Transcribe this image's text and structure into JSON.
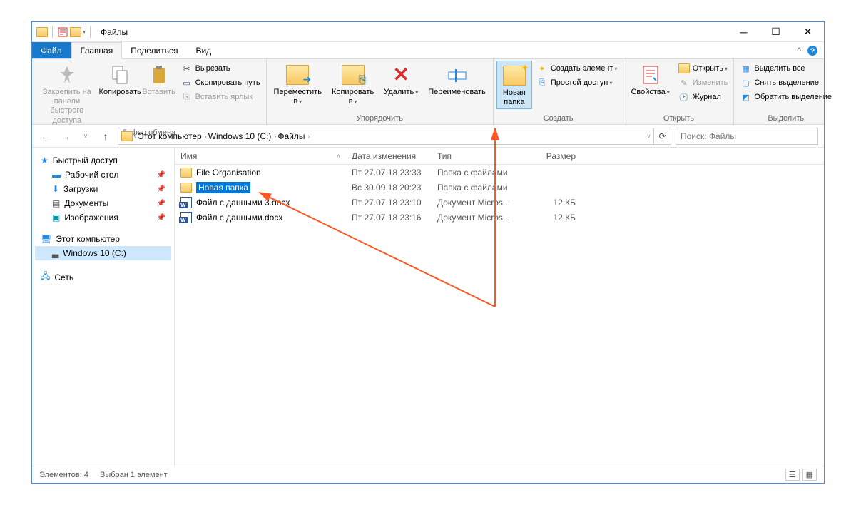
{
  "window": {
    "title": "Файлы"
  },
  "tabs": {
    "file": "Файл",
    "home": "Главная",
    "share": "Поделиться",
    "view": "Вид"
  },
  "ribbon": {
    "clipboard": {
      "label": "Буфер обмена",
      "pin": "Закрепить на панели\nбыстрого доступа",
      "copy": "Копировать",
      "paste": "Вставить",
      "cut": "Вырезать",
      "copy_path": "Скопировать путь",
      "paste_shortcut": "Вставить ярлык"
    },
    "organize": {
      "label": "Упорядочить",
      "move_to": "Переместить\nв",
      "copy_to": "Копировать\nв",
      "delete": "Удалить",
      "rename": "Переименовать"
    },
    "new": {
      "label": "Создать",
      "new_folder": "Новая\nпапка",
      "new_item": "Создать элемент",
      "easy_access": "Простой доступ"
    },
    "open": {
      "label": "Открыть",
      "properties": "Свойства",
      "open_btn": "Открыть",
      "edit": "Изменить",
      "history": "Журнал"
    },
    "select": {
      "label": "Выделить",
      "select_all": "Выделить все",
      "select_none": "Снять выделение",
      "invert": "Обратить выделение"
    }
  },
  "breadcrumbs": [
    "Этот компьютер",
    "Windows 10 (C:)",
    "Файлы"
  ],
  "search_placeholder": "Поиск: Файлы",
  "sidebar": {
    "quick_access": "Быстрый доступ",
    "desktop": "Рабочий стол",
    "downloads": "Загрузки",
    "documents": "Документы",
    "pictures": "Изображения",
    "this_pc": "Этот компьютер",
    "drive_c": "Windows 10 (C:)",
    "network": "Сеть"
  },
  "columns": {
    "name": "Имя",
    "date": "Дата изменения",
    "type": "Тип",
    "size": "Размер"
  },
  "files": [
    {
      "name": "File Organisation",
      "date": "Пт 27.07.18 23:33",
      "type": "Папка с файлами",
      "size": ""
    },
    {
      "name": "Новая папка",
      "date": "Вс 30.09.18 20:23",
      "type": "Папка с файлами",
      "size": "",
      "renaming": true
    },
    {
      "name": "Файл с данными 3.docx",
      "date": "Пт 27.07.18 23:10",
      "type": "Документ Micros...",
      "size": "12 КБ"
    },
    {
      "name": "Файл с данными.docx",
      "date": "Пт 27.07.18 23:16",
      "type": "Документ Micros...",
      "size": "12 КБ"
    }
  ],
  "status": {
    "count": "Элементов: 4",
    "selected": "Выбран 1 элемент"
  }
}
